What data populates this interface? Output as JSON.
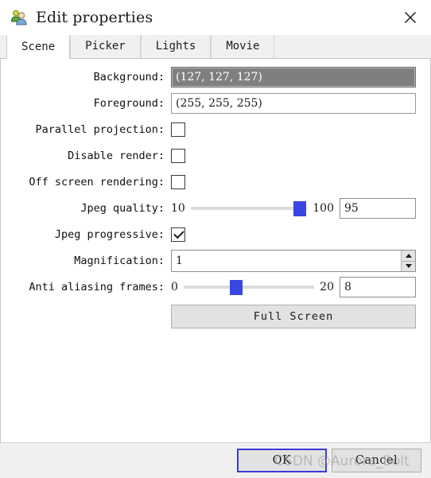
{
  "window": {
    "title": "Edit properties",
    "icon": "users-icon",
    "close_label": "✕"
  },
  "tabs": [
    {
      "label": "Scene",
      "active": true
    },
    {
      "label": "Picker",
      "active": false
    },
    {
      "label": "Lights",
      "active": false
    },
    {
      "label": "Movie",
      "active": false
    }
  ],
  "scene": {
    "background": {
      "label": "Background:",
      "value": "(127, 127, 127)",
      "swatch_color": "#7f7f7f"
    },
    "foreground": {
      "label": "Foreground:",
      "value": "(255, 255, 255)"
    },
    "parallel_projection": {
      "label": "Parallel projection:",
      "checked": false
    },
    "disable_render": {
      "label": "Disable render:",
      "checked": false
    },
    "off_screen_rendering": {
      "label": "Off screen rendering:",
      "checked": false
    },
    "jpeg_quality": {
      "label": "Jpeg quality:",
      "min": "10",
      "max": "100",
      "value": "95",
      "handle_percent": 94
    },
    "jpeg_progressive": {
      "label": "Jpeg progressive:",
      "checked": true
    },
    "magnification": {
      "label": "Magnification:",
      "value": "1"
    },
    "anti_aliasing_frames": {
      "label": "Anti aliasing frames:",
      "min": "0",
      "max": "20",
      "value": "8",
      "handle_percent": 40
    },
    "full_screen_button": "Full Screen"
  },
  "footer": {
    "ok_label": "OK",
    "cancel_label": "Cancel"
  },
  "watermark": {
    "text": "CSDN @Aurora_Bolt"
  },
  "colors": {
    "accent": "#3a3ad8",
    "slider_handle": "#3a46e0",
    "background_swatch": "#7f7f7f",
    "tab_inactive": "#f0f0f0"
  }
}
